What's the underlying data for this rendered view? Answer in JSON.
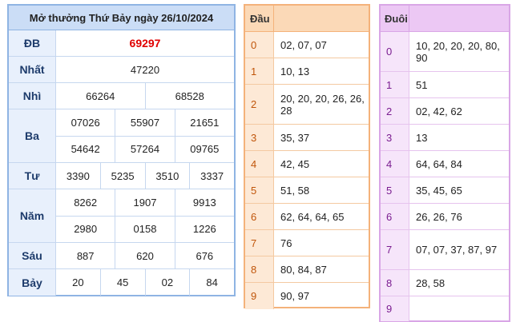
{
  "results": {
    "title": "Mở thưởng Thứ Bảy ngày 26/10/2024",
    "prizes": [
      {
        "label": "ĐB",
        "lines": [
          [
            "69297"
          ]
        ],
        "special": true
      },
      {
        "label": "Nhất",
        "lines": [
          [
            "47220"
          ]
        ]
      },
      {
        "label": "Nhì",
        "lines": [
          [
            "66264",
            "68528"
          ]
        ]
      },
      {
        "label": "Ba",
        "lines": [
          [
            "07026",
            "55907",
            "21651"
          ],
          [
            "54642",
            "57264",
            "09765"
          ]
        ]
      },
      {
        "label": "Tư",
        "lines": [
          [
            "3390",
            "5235",
            "3510",
            "3337"
          ]
        ]
      },
      {
        "label": "Năm",
        "lines": [
          [
            "8262",
            "1907",
            "9913"
          ],
          [
            "2980",
            "0158",
            "1226"
          ]
        ]
      },
      {
        "label": "Sáu",
        "lines": [
          [
            "887",
            "620",
            "676"
          ]
        ]
      },
      {
        "label": "Bảy",
        "lines": [
          [
            "20",
            "45",
            "02",
            "84"
          ]
        ]
      }
    ]
  },
  "dau": {
    "header": "Đầu",
    "rows": [
      {
        "key": "0",
        "value": "02, 07, 07"
      },
      {
        "key": "1",
        "value": "10, 13"
      },
      {
        "key": "2",
        "value": "20, 20, 20, 26, 26, 28"
      },
      {
        "key": "3",
        "value": "35, 37"
      },
      {
        "key": "4",
        "value": "42, 45"
      },
      {
        "key": "5",
        "value": "51, 58"
      },
      {
        "key": "6",
        "value": "62, 64, 64, 65"
      },
      {
        "key": "7",
        "value": "76"
      },
      {
        "key": "8",
        "value": "80, 84, 87"
      },
      {
        "key": "9",
        "value": "90, 97"
      }
    ]
  },
  "duoi": {
    "header": "Đuôi",
    "rows": [
      {
        "key": "0",
        "value": "10, 20, 20, 20, 80, 90"
      },
      {
        "key": "1",
        "value": "51"
      },
      {
        "key": "2",
        "value": "02, 42, 62"
      },
      {
        "key": "3",
        "value": "13"
      },
      {
        "key": "4",
        "value": "64, 64, 84"
      },
      {
        "key": "5",
        "value": "35, 45, 65"
      },
      {
        "key": "6",
        "value": "26, 26, 76"
      },
      {
        "key": "7",
        "value": "07, 07, 37, 87, 97"
      },
      {
        "key": "8",
        "value": "28, 58"
      },
      {
        "key": "9",
        "value": ""
      }
    ]
  },
  "colors": {
    "special_prize": "#e00000",
    "results_border": "#8fb4e3",
    "dau_border": "#f4b27a",
    "duoi_border": "#d9a6e6"
  }
}
